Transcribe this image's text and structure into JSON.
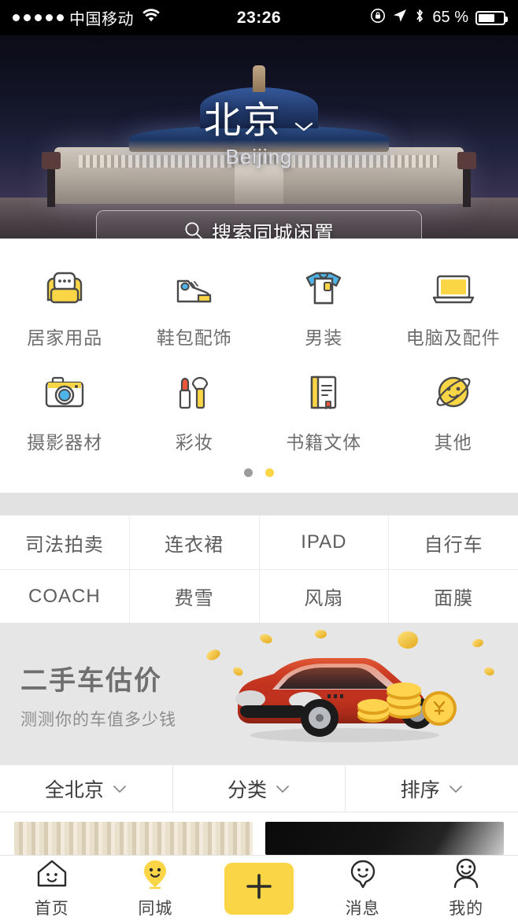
{
  "status_bar": {
    "signal_dots": 5,
    "carrier": "中国移动",
    "wifi_icon": "wifi-icon",
    "time": "23:26",
    "rotation_lock_icon": "rotation-lock-icon",
    "location_icon": "location-arrow-icon",
    "bluetooth_icon": "bluetooth-icon",
    "battery_percent": "65 %",
    "battery_level": 65
  },
  "hero": {
    "city_cn": "北京",
    "city_en": "Beijing",
    "chevron_icon": "chevron-down-icon",
    "search": {
      "icon": "search-icon",
      "placeholder": "搜索同城闲置",
      "value": ""
    }
  },
  "categories": {
    "rows": [
      [
        {
          "label": "居家用品",
          "icon": "sofa-icon"
        },
        {
          "label": "鞋包配饰",
          "icon": "shoe-icon"
        },
        {
          "label": "男装",
          "icon": "tshirt-icon"
        },
        {
          "label": "电脑及配件",
          "icon": "laptop-icon"
        }
      ],
      [
        {
          "label": "摄影器材",
          "icon": "camera-icon"
        },
        {
          "label": "彩妆",
          "icon": "makeup-icon"
        },
        {
          "label": "书籍文体",
          "icon": "book-icon"
        },
        {
          "label": "其他",
          "icon": "planet-smile-icon"
        }
      ]
    ],
    "pager": {
      "total": 2,
      "active_index": 1
    }
  },
  "keywords": {
    "rows": [
      [
        "司法拍卖",
        "连衣裙",
        "IPAD",
        "自行车"
      ],
      [
        "COACH",
        "费雪",
        "风扇",
        "面膜"
      ]
    ]
  },
  "banner": {
    "title": "二手车估价",
    "subtitle": "测测你的车值多少钱",
    "image": "red-sedan-with-coins-illustration"
  },
  "filters": [
    {
      "label": "全北京",
      "icon": "chevron-down-icon"
    },
    {
      "label": "分类",
      "icon": "chevron-down-icon"
    },
    {
      "label": "排序",
      "icon": "chevron-down-icon"
    }
  ],
  "product_cards": [
    {
      "image": "light-wood-striped-photo"
    },
    {
      "image": "dark-object-photo"
    }
  ],
  "tabbar": {
    "items": [
      {
        "label": "首页",
        "icon": "home-smile-icon",
        "active": false
      },
      {
        "label": "同城",
        "icon": "location-pin-smile-icon",
        "active": true
      },
      {
        "label": "",
        "icon": "plus-icon",
        "active": false
      },
      {
        "label": "消息",
        "icon": "chat-smile-icon",
        "active": false
      },
      {
        "label": "我的",
        "icon": "person-smile-icon",
        "active": false
      }
    ]
  },
  "colors": {
    "brand_yellow": "#FAD646",
    "text_gray": "#6e6e6e",
    "divider": "#e6e6e6",
    "section_gap": "#e2e2e2",
    "status_bar_bg": "#000000"
  }
}
